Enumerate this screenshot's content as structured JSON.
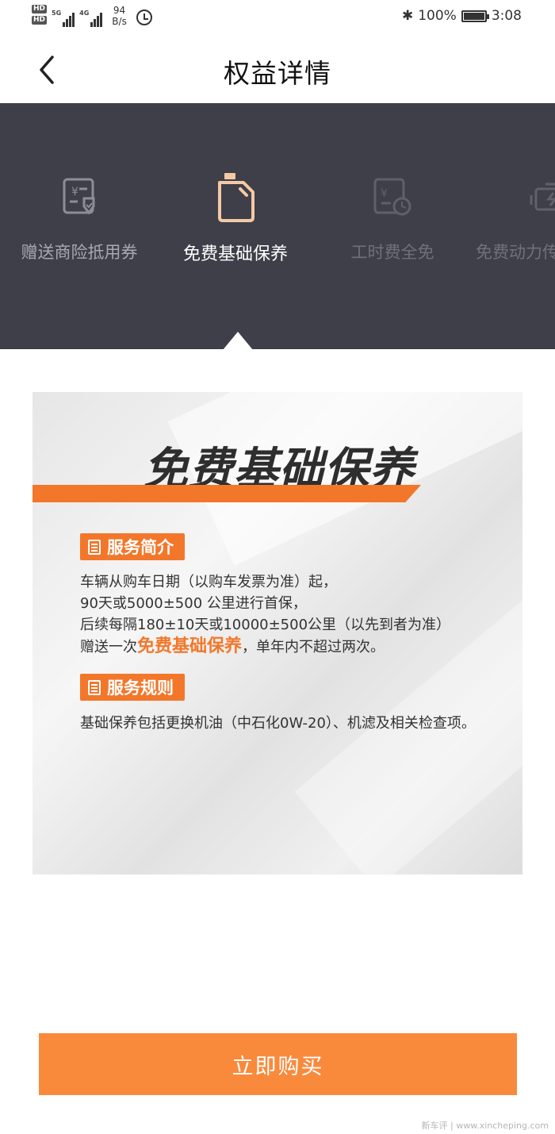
{
  "status_bar": {
    "hd_badge": "HD",
    "signal_1_label": "5G",
    "signal_2_label": "4G",
    "net_speed_value": "94",
    "net_speed_unit": "B/s",
    "battery_percent": "100%",
    "time": "3:08"
  },
  "header": {
    "title": "权益详情"
  },
  "benefit_tabs": [
    {
      "label": "赠送商险抵用券",
      "icon": "insurance-voucher-icon"
    },
    {
      "label": "免费基础保养",
      "icon": "oil-can-icon",
      "selected": true
    },
    {
      "label": "工时费全免",
      "icon": "labor-fee-icon"
    },
    {
      "label": "免费动力传",
      "icon": "engine-icon"
    }
  ],
  "promo": {
    "heading": "免费基础保养",
    "intro_badge": "服务简介",
    "intro_line_1": "车辆从购车日期（以购车发票为准）起，",
    "intro_line_2": "90天或5000±500 公里进行首保，",
    "intro_line_3": "后续每隔180±10天或10000±500公里（以先到者为准）",
    "intro_line_4_prefix": "赠送一次",
    "intro_line_4_highlight": "免费基础保养",
    "intro_line_4_suffix": "，单年内不超过两次。",
    "rules_badge": "服务规则",
    "rules_text": "基础保养包括更换机油（中石化0W-20）、机滤及相关检查项。"
  },
  "actions": {
    "buy_label": "立即购买"
  },
  "watermark": "新车评 | www.xincheping.com",
  "colors": {
    "accent": "#f2772b",
    "button": "#f98a3c",
    "tab_bar": "#3e3f48"
  }
}
